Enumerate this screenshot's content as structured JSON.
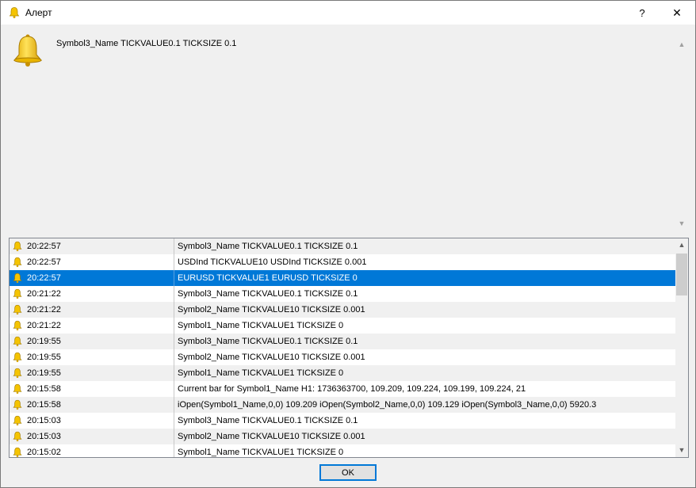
{
  "window": {
    "title": "Алерт",
    "help_label": "?",
    "close_label": "✕"
  },
  "message": "Symbol3_Name TICKVALUE0.1 TICKSIZE 0.1",
  "alerts": [
    {
      "time": "20:22:57",
      "text": "Symbol3_Name TICKVALUE0.1 TICKSIZE 0.1"
    },
    {
      "time": "20:22:57",
      "text": "USDInd TICKVALUE10 USDInd TICKSIZE 0.001"
    },
    {
      "time": "20:22:57",
      "text": "EURUSD TICKVALUE1 EURUSD TICKSIZE 0"
    },
    {
      "time": "20:21:22",
      "text": "Symbol3_Name TICKVALUE0.1 TICKSIZE 0.1"
    },
    {
      "time": "20:21:22",
      "text": "Symbol2_Name TICKVALUE10 TICKSIZE 0.001"
    },
    {
      "time": "20:21:22",
      "text": "Symbol1_Name TICKVALUE1 TICKSIZE 0"
    },
    {
      "time": "20:19:55",
      "text": "Symbol3_Name TICKVALUE0.1 TICKSIZE 0.1"
    },
    {
      "time": "20:19:55",
      "text": "Symbol2_Name TICKVALUE10 TICKSIZE 0.001"
    },
    {
      "time": "20:19:55",
      "text": "Symbol1_Name TICKVALUE1 TICKSIZE 0"
    },
    {
      "time": "20:15:58",
      "text": "Current bar for Symbol1_Name H1: 1736363700, 109.209, 109.224, 109.199, 109.224, 21"
    },
    {
      "time": "20:15:58",
      "text": " iOpen(Symbol1_Name,0,0) 109.209 iOpen(Symbol2_Name,0,0) 109.129 iOpen(Symbol3_Name,0,0) 5920.3"
    },
    {
      "time": "20:15:03",
      "text": "Symbol3_Name TICKVALUE0.1 TICKSIZE 0.1"
    },
    {
      "time": "20:15:03",
      "text": "Symbol2_Name TICKVALUE10 TICKSIZE 0.001"
    },
    {
      "time": "20:15:02",
      "text": "Symbol1_Name TICKVALUE1 TICKSIZE 0"
    }
  ],
  "selected_index": 2,
  "ok_label": "OK",
  "colors": {
    "selection": "#0078d7",
    "bell": "#f5c400"
  }
}
